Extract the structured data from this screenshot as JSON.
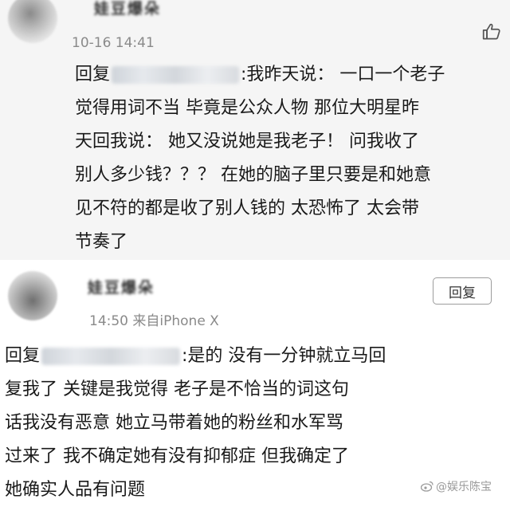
{
  "comment1": {
    "username": "娃豆爆朵",
    "timestamp": "10-16 14:41",
    "reply_prefix": "回复",
    "lines": [
      ":我昨天说： 一口一个老子",
      "觉得用词不当 毕竟是公众人物 那位大明星昨",
      "天回我说： 她又没说她是我老子！ 问我收了",
      "别人多少钱？？？ 在她的脑子里只要是和她意",
      "见不符的都是收了别人钱的 太恐怖了 太会带",
      "节奏了"
    ],
    "like_icon": "thumbs-up-icon"
  },
  "comment2": {
    "username": "娃豆爆朵",
    "meta": "14:50 来自iPhone X",
    "reply_button": "回复",
    "reply_prefix": "回复",
    "lines": [
      ":是的 没有一分钟就立马回",
      "复我了 关键是我觉得 老子是不恰当的词这句",
      "话我没有恶意 她立马带着她的粉丝和水军骂",
      "过来了 我不确定她有没有抑郁症 但我确定了",
      "她确实人品有问题"
    ]
  },
  "watermark": "@娱乐陈宝"
}
